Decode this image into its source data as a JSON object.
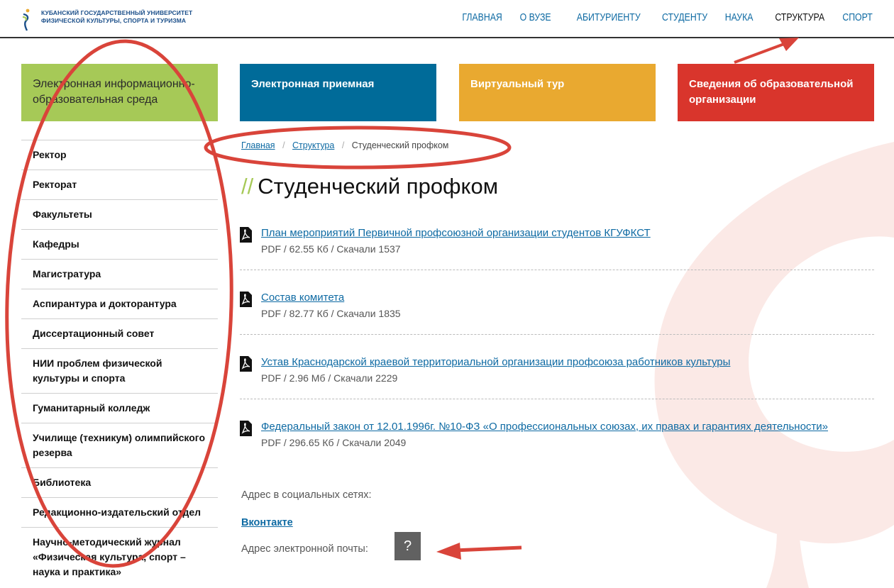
{
  "header": {
    "logo_text_line1": "КУБАНСКИЙ ГОСУДАРСТВЕННЫЙ УНИВЕРСИТЕТ",
    "logo_text_line2": "ФИЗИЧЕСКОЙ КУЛЬТУРЫ, СПОРТА И ТУРИЗМА",
    "nav": [
      "ГЛАВНАЯ",
      "О ВУЗЕ",
      "АБИТУРИЕНТУ",
      "СТУДЕНТУ",
      "НАУКА",
      "СТРУКТУРА",
      "СПОРТ"
    ],
    "active_nav": "СТРУКТУРА"
  },
  "tiles": [
    {
      "label": "Электронная информационно-образовательная среда",
      "color": "#a6c957"
    },
    {
      "label": "Электронная приемная",
      "color": "#006b99"
    },
    {
      "label": "Виртуальный тур",
      "color": "#e9a930"
    },
    {
      "label": "Сведения об образовательной организации",
      "color": "#d9352c"
    }
  ],
  "sidebar": {
    "items": [
      "Ректор",
      "Ректорат",
      "Факультеты",
      "Кафедры",
      "Магистратура",
      "Аспирантура и докторантура",
      "Диссертационный совет",
      "НИИ проблем физической культуры и спорта",
      "Гуманитарный колледж",
      "Училище (техникум) олимпийского резерва",
      "Библиотека",
      "Редакционно-издательский отдел",
      "Научно-методический журнал «Физическая культура, спорт – наука и практика»"
    ]
  },
  "breadcrumb": {
    "home": "Главная",
    "section": "Структура",
    "current": "Студенческий профком"
  },
  "page": {
    "title_prefix": "//",
    "title": "Студенческий профком"
  },
  "documents": [
    {
      "title": "План мероприятий Первичной профсоюзной организации студентов КГУФКСТ",
      "meta": "PDF / 62.55 Кб / Скачали 1537",
      "icon": "pdf-icon"
    },
    {
      "title": "Состав комитета",
      "meta": "PDF / 82.77 Кб / Скачали 1835",
      "icon": "pdf-icon"
    },
    {
      "title": "Устав Краснодарской краевой территориальной организации профсоюза работников культуры",
      "meta": "PDF / 2.96 Мб / Скачали 2229",
      "icon": "pdf-icon"
    },
    {
      "title": "Федеральный закон от 12.01.1996г. №10-ФЗ «О профессиональных союзах, их правах и гарантиях деятельности»",
      "meta": "PDF / 296.65 Кб / Скачали 2049",
      "icon": "pdf-icon"
    }
  ],
  "social": {
    "heading": "Адрес в социальных сетях:",
    "vk_label": "Вконтакте",
    "email_label": "Адрес электронной почты:",
    "email_button": "?"
  },
  "colors": {
    "link": "#0e6aa3",
    "annotation": "#d9443a",
    "accent_green": "#a6c957"
  }
}
